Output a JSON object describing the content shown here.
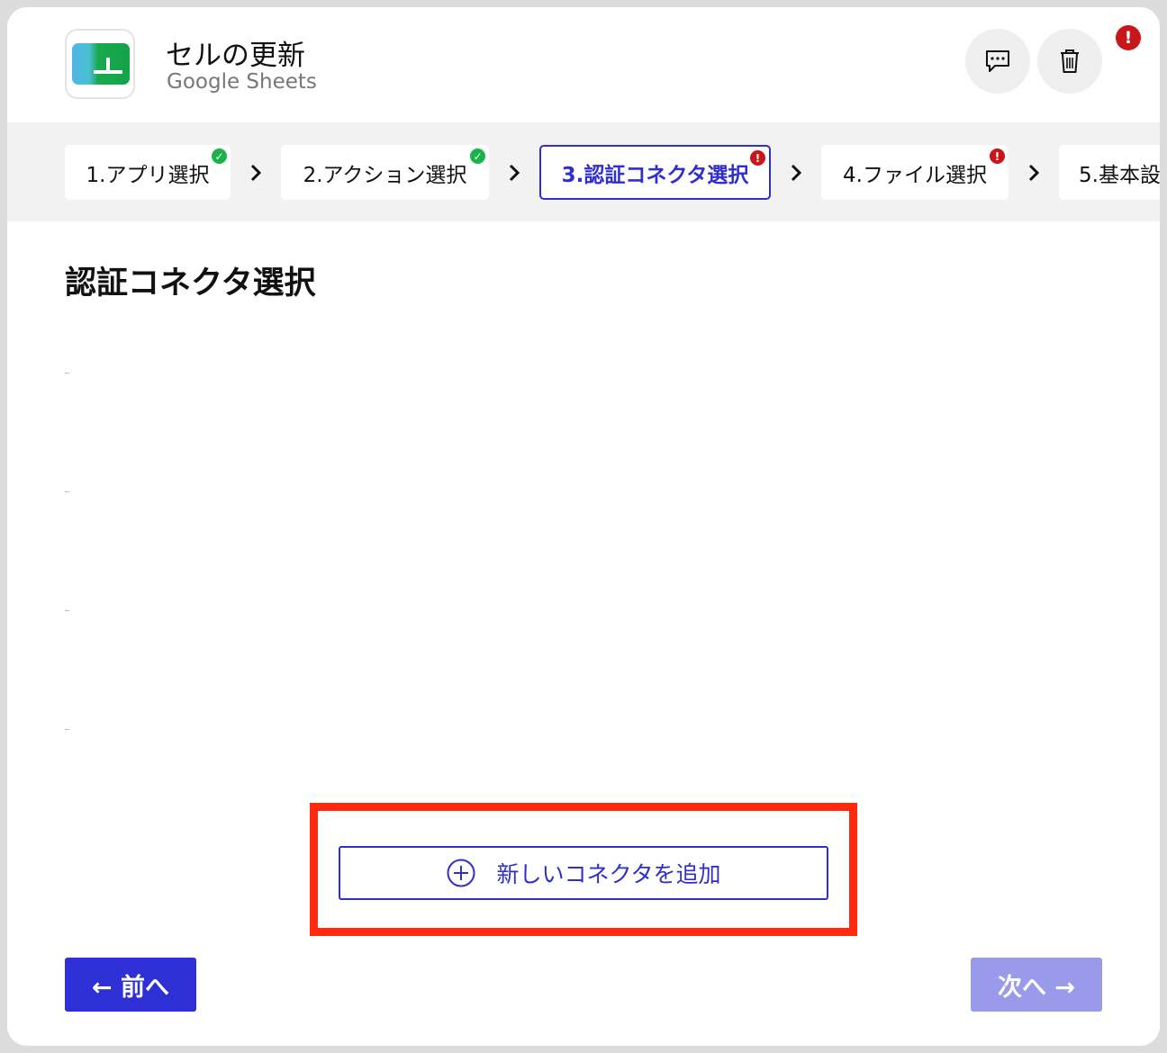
{
  "header": {
    "title": "セルの更新",
    "subtitle": "Google Sheets",
    "alert_badge": "!",
    "comment_icon": "comment-dots-icon",
    "delete_icon": "trash-icon"
  },
  "steps": [
    {
      "label": "1.アプリ選択",
      "status": "complete"
    },
    {
      "label": "2.アクション選択",
      "status": "complete"
    },
    {
      "label": "3.認証コネクタ選択",
      "status": "error",
      "active": true
    },
    {
      "label": "4.ファイル選択",
      "status": "error"
    },
    {
      "label": "5.基本設",
      "status": "none"
    }
  ],
  "main": {
    "section_title": "認証コネクタ選択",
    "add_connector_label": "新しいコネクタを追加"
  },
  "footer": {
    "prev_label": "← 前へ",
    "next_label": "次へ →"
  },
  "colors": {
    "accent": "#2f2fcc",
    "success": "#19b34a",
    "error": "#c8161a",
    "highlight": "#ff2a0e",
    "disabled": "#9a9aea"
  }
}
